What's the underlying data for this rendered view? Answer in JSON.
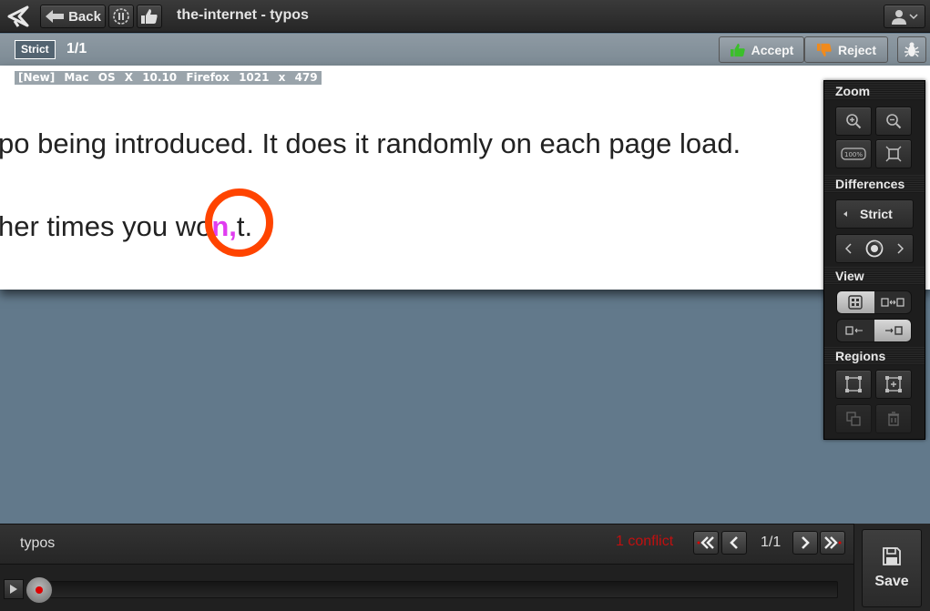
{
  "topbar": {
    "back_label": "Back",
    "page_title": "the-internet - typos",
    "icons": [
      "applitools-logo",
      "back-arrow-icon",
      "pause-icon",
      "thumbs-up-icon",
      "user-icon",
      "chevron-down-icon"
    ]
  },
  "subbar": {
    "match_level": "Strict",
    "step_count": "1/1",
    "accept_label": "Accept",
    "reject_label": "Reject"
  },
  "screenshot": {
    "meta": "[New] Mac OS X 10.10 Firefox 1021 x 479",
    "line1": "po being introduced. It does it randomly on each page load.",
    "line2_before": "her times you wo",
    "line2_diff": "n,",
    "line2_after": "t."
  },
  "panel": {
    "zoom_label": "Zoom",
    "zoom_100": "100%",
    "differences_label": "Differences",
    "strict_label": "Strict",
    "view_label": "View",
    "regions_label": "Regions"
  },
  "bottombar": {
    "job_name": "typos",
    "conflict": "1 conflict",
    "pager": "1/1",
    "save_label": "Save"
  },
  "colors": {
    "accent_conflict": "#c01010",
    "diff_ring": "#ff4400",
    "diff_mark": "#e03cf0",
    "accept_thumb": "#3bbf2a",
    "reject_thumb": "#f08a1c"
  }
}
